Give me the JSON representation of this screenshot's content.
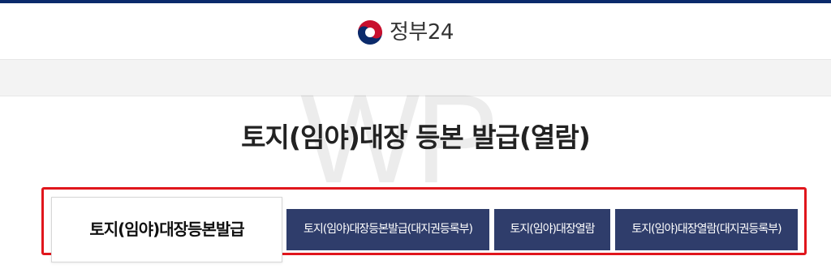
{
  "header": {
    "brand_text": "정부24",
    "brand_icon": "taegeuk-icon",
    "stripe_color": "#0b2a6b"
  },
  "watermark": {
    "text": "WP"
  },
  "page": {
    "title": "토지(임야)대장 등본 발급(열람)"
  },
  "tabs": [
    {
      "label": "토지(임야)대장등본발급",
      "active": true
    },
    {
      "label": "토지(임야)대장등본발급(대지권등록부)",
      "active": false
    },
    {
      "label": "토지(임야)대장열람",
      "active": false
    },
    {
      "label": "토지(임야)대장열람(대지권등록부)",
      "active": false
    }
  ],
  "colors": {
    "tab_dark": "#2f3d6b",
    "highlight": "#e0161c"
  }
}
